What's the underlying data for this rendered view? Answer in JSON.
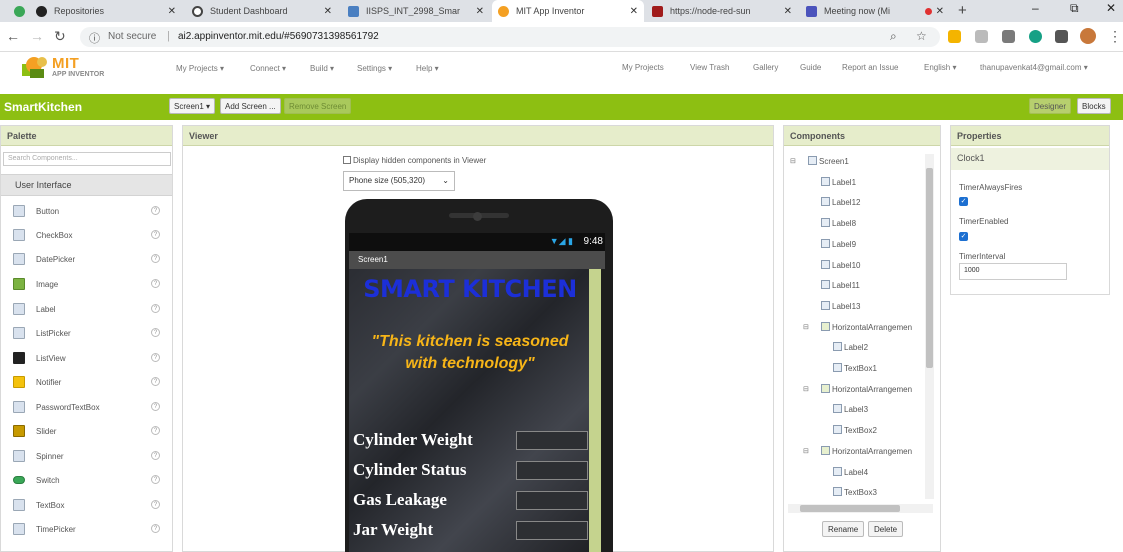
{
  "browser": {
    "tabs": [
      {
        "label": "Repositories",
        "color": "#222222"
      },
      {
        "label": "Student Dashboard",
        "color": "#444444"
      },
      {
        "label": "IISPS_INT_2998_Smar",
        "color": "#4a7fc1"
      },
      {
        "label": "MIT App Inventor",
        "color": "#f4a023"
      },
      {
        "label": "https://node-red-sun",
        "color": "#a01b1b"
      },
      {
        "label": "Meeting now (Mi",
        "color": "#4b53bc"
      }
    ],
    "new_tab": "+",
    "window_controls": [
      "–",
      "⧉",
      "✕"
    ],
    "address": {
      "security": "Not secure",
      "url": "ai2.appinventor.mit.edu/#5690731398561792"
    }
  },
  "header": {
    "logo_text": "MIT",
    "logo_sub": "APP INVENTOR",
    "menus": [
      "My Projects ▾",
      "Connect ▾",
      "Build ▾",
      "Settings ▾",
      "Help ▾"
    ],
    "right_links": [
      "My Projects",
      "View Trash",
      "Gallery",
      "Guide",
      "Report an Issue",
      "English ▾",
      "thanupavenkat4@gmail.com ▾"
    ]
  },
  "project_bar": {
    "name": "SmartKitchen",
    "screen_select": "Screen1 ▾",
    "add_screen": "Add Screen ...",
    "remove_screen": "Remove Screen",
    "designer": "Designer",
    "blocks": "Blocks"
  },
  "palette": {
    "title": "Palette",
    "search_placeholder": "Search Components...",
    "category": "User Interface",
    "items": [
      "Button",
      "CheckBox",
      "DatePicker",
      "Image",
      "Label",
      "ListPicker",
      "ListView",
      "Notifier",
      "PasswordTextBox",
      "Slider",
      "Spinner",
      "Switch",
      "TextBox",
      "TimePicker"
    ]
  },
  "viewer": {
    "title": "Viewer",
    "hidden_checkbox_label": "Display hidden components in Viewer",
    "phone_size": "Phone size (505,320)",
    "status_time": "9:48",
    "screen_title": "Screen1",
    "app_title": "SMART KITCHEN",
    "slogan": "\"This kitchen is seasoned with technology\"",
    "rows": [
      "Cylinder Weight",
      "Cylinder Status",
      "Gas Leakage",
      "Jar Weight"
    ]
  },
  "components": {
    "title": "Components",
    "tree": [
      {
        "label": "Screen1",
        "level": 0,
        "expand": "⊟"
      },
      {
        "label": "Label1",
        "level": 1
      },
      {
        "label": "Label12",
        "level": 1
      },
      {
        "label": "Label8",
        "level": 1
      },
      {
        "label": "Label9",
        "level": 1
      },
      {
        "label": "Label10",
        "level": 1
      },
      {
        "label": "Label11",
        "level": 1
      },
      {
        "label": "Label13",
        "level": 1
      },
      {
        "label": "HorizontalArrangemen",
        "level": 1,
        "expand": "⊟",
        "arr": true
      },
      {
        "label": "Label2",
        "level": 2
      },
      {
        "label": "TextBox1",
        "level": 2
      },
      {
        "label": "HorizontalArrangemen",
        "level": 1,
        "expand": "⊟",
        "arr": true
      },
      {
        "label": "Label3",
        "level": 2
      },
      {
        "label": "TextBox2",
        "level": 2
      },
      {
        "label": "HorizontalArrangemen",
        "level": 1,
        "expand": "⊟",
        "arr": true
      },
      {
        "label": "Label4",
        "level": 2
      },
      {
        "label": "TextBox3",
        "level": 2
      }
    ],
    "rename": "Rename",
    "delete": "Delete"
  },
  "properties": {
    "title": "Properties",
    "component": "Clock1",
    "timer_always_fires_label": "TimerAlwaysFires",
    "timer_always_fires": true,
    "timer_enabled_label": "TimerEnabled",
    "timer_enabled": true,
    "timer_interval_label": "TimerInterval",
    "timer_interval": "1000"
  },
  "colors": {
    "brand_green": "#8dbf12",
    "panel_head": "#e6edcb",
    "app_title_blue": "#1c2fd8",
    "slogan_gold": "#f7b518"
  }
}
